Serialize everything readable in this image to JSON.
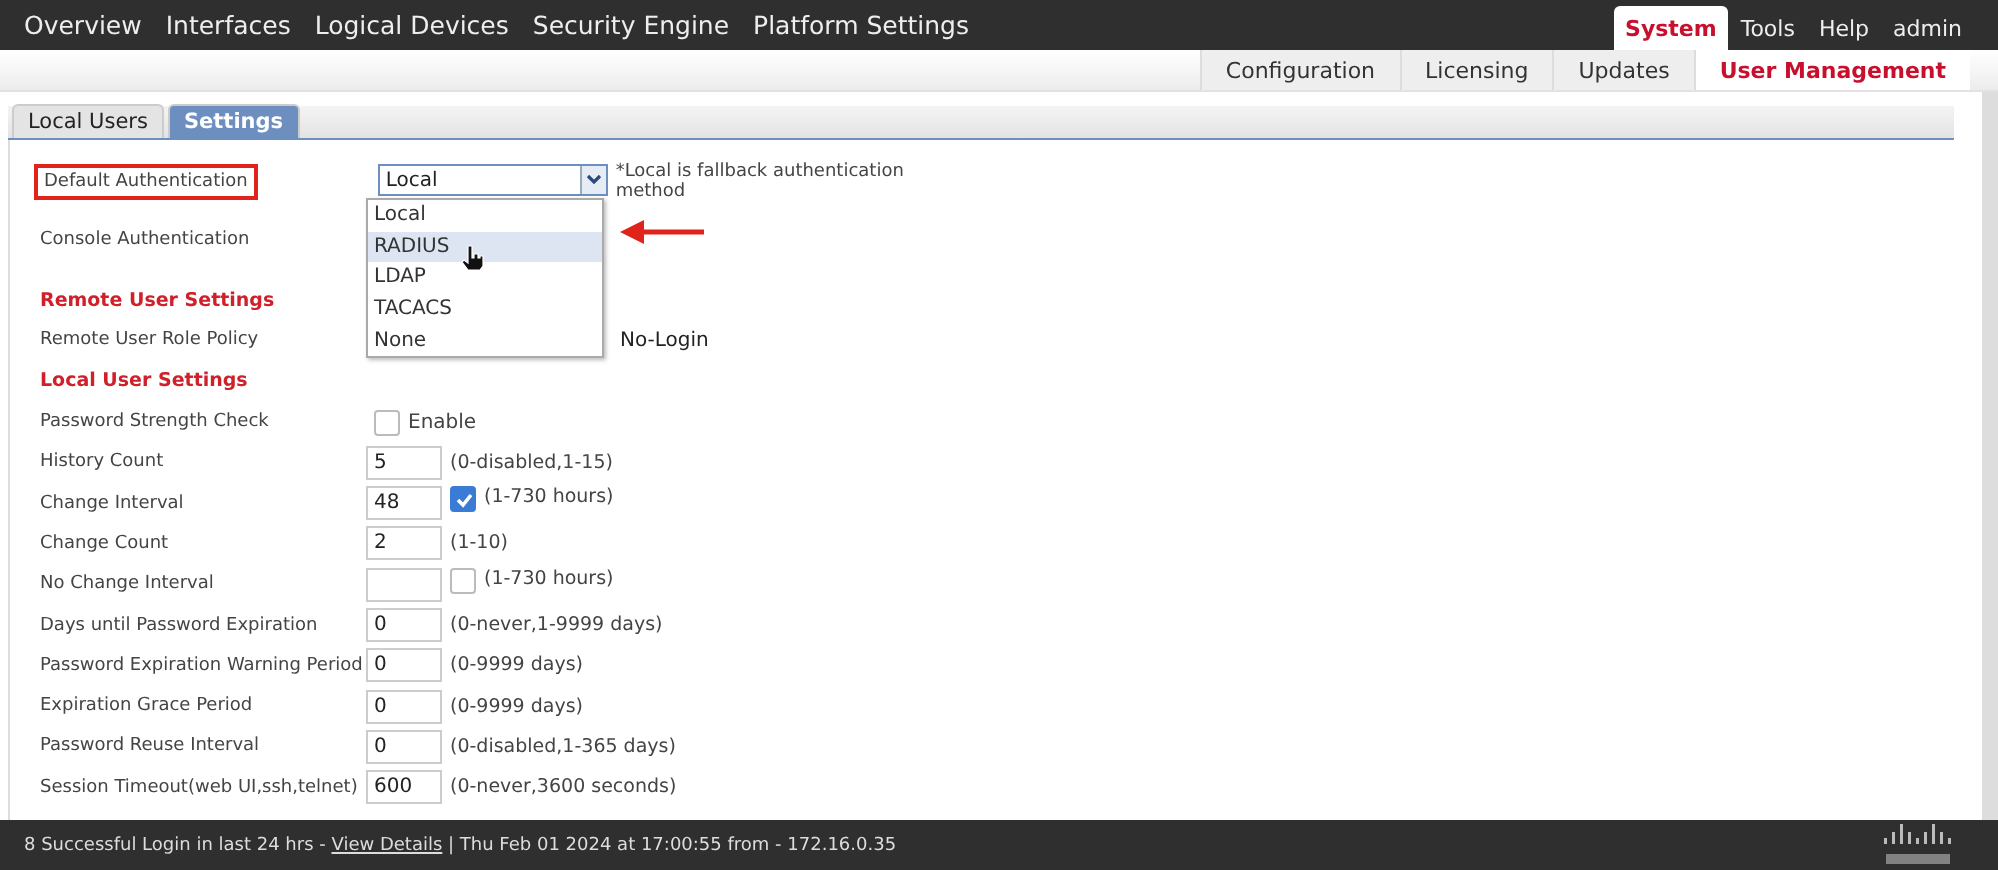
{
  "nav": [
    {
      "label": "Overview",
      "selected": false
    },
    {
      "label": "Interfaces",
      "selected": false
    },
    {
      "label": "Logical Devices",
      "selected": false
    },
    {
      "label": "Security Engine",
      "selected": false
    },
    {
      "label": "Platform Settings",
      "selected": false
    }
  ],
  "utility_nav": [
    {
      "label": "System",
      "selected": true
    },
    {
      "label": "Tools",
      "selected": false
    },
    {
      "label": "Help",
      "selected": false
    },
    {
      "label": "admin",
      "selected": false
    }
  ],
  "subnav": [
    {
      "label": "Configuration",
      "selected": false
    },
    {
      "label": "Licensing",
      "selected": false
    },
    {
      "label": "Updates",
      "selected": false
    },
    {
      "label": "User Management",
      "selected": true
    }
  ],
  "tabs": [
    {
      "label": "Local Users",
      "selected": false
    },
    {
      "label": "Settings",
      "selected": true
    }
  ],
  "default_authentication": {
    "label": "Default Authentication",
    "value": "Local",
    "note": "*Local is fallback authentication method",
    "options": [
      {
        "label": "Local",
        "highlighted": false
      },
      {
        "label": "RADIUS",
        "highlighted": true
      },
      {
        "label": "LDAP",
        "highlighted": false
      },
      {
        "label": "TACACS",
        "highlighted": false
      },
      {
        "label": "None",
        "highlighted": false
      }
    ]
  },
  "console_authentication": {
    "label": "Console Authentication"
  },
  "remote_section": {
    "title": "Remote User Settings",
    "policy_label": "Remote User Role Policy",
    "policy_option": "No-Login"
  },
  "local_section": {
    "title": "Local User Settings"
  },
  "rows": [
    {
      "kind": "checkbox",
      "label": "Password Strength Check",
      "checked": false,
      "text": "Enable"
    },
    {
      "kind": "field",
      "label": "History Count",
      "value": "5",
      "hint": "(0-disabled,1-15)"
    },
    {
      "kind": "field_check",
      "label": "Change Interval",
      "value": "48",
      "checked": true,
      "hint": "(1-730 hours)"
    },
    {
      "kind": "field",
      "label": "Change Count",
      "value": "2",
      "hint": "(1-10)"
    },
    {
      "kind": "field_check",
      "label": "No Change Interval",
      "checked": false,
      "hint": "(1-730 hours)"
    },
    {
      "kind": "field",
      "label": "Days until Password Expiration",
      "value": "0",
      "hint": "(0-never,1-9999 days)"
    },
    {
      "kind": "field",
      "label": "Password Expiration Warning Period",
      "value": "0",
      "hint": "(0-9999 days)"
    },
    {
      "kind": "field",
      "label": "Expiration Grace Period",
      "value": "0",
      "hint": "(0-9999 days)"
    },
    {
      "kind": "field",
      "label": "Password Reuse Interval",
      "value": "0",
      "hint": "(0-disabled,1-365 days)"
    },
    {
      "kind": "field",
      "label": "Session Timeout(web UI,ssh,telnet)",
      "value": "600",
      "hint": "(0-never,3600 seconds)"
    }
  ],
  "status_bar": {
    "text": "8 Successful Login in last 24 hrs - ",
    "link": "View Details",
    "suffix": " | Thu Feb 01 2024 at 17:00:55 from - 172.16.0.35"
  }
}
